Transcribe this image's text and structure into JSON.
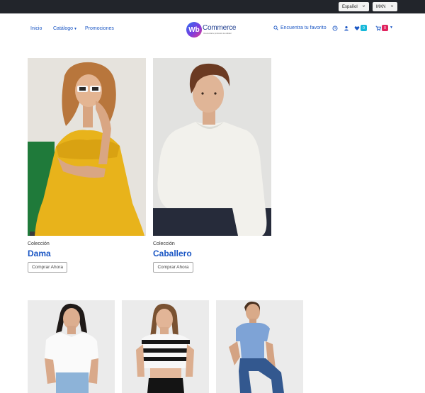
{
  "topbar": {
    "language": "Español",
    "currency": "MXN"
  },
  "nav": {
    "inicio": "Inicio",
    "catalogo": "Catálogo",
    "promociones": "Promociones"
  },
  "logo": {
    "badge": "Wb",
    "word": "Commerce",
    "tagline": "Una tienda de productos de calidad"
  },
  "header": {
    "search_label": "Encuentra tu favorito",
    "wishlist_count": "0",
    "cart_count": "0"
  },
  "collections": [
    {
      "label": "Colección",
      "name": "Dama",
      "button": "Comprar Ahora"
    },
    {
      "label": "Colección",
      "name": "Caballero",
      "button": "Comprar Ahora"
    }
  ],
  "colors": {
    "accent": "#1a56c4",
    "topbar": "#22252b",
    "wishlist_badge": "#16b8d9",
    "cart_badge": "#e0245e"
  },
  "icons": {
    "search": "search-icon",
    "account": "user-icon",
    "wishlist": "heart-icon",
    "cart": "cart-icon",
    "history": "clock-icon"
  }
}
